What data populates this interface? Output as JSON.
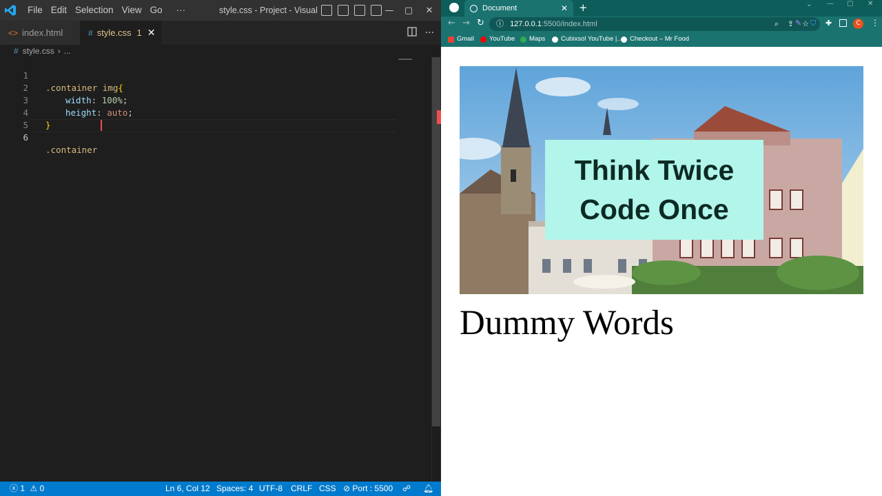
{
  "vscode": {
    "menu": [
      "File",
      "Edit",
      "Selection",
      "View",
      "Go",
      "···"
    ],
    "title": "style.css - Project - Visual ...",
    "window_controls": [
      "—",
      "▢",
      "✕"
    ],
    "tabs": {
      "index": {
        "label": "index.html",
        "icon": "<>"
      },
      "style": {
        "label": "style.css",
        "icon": "#",
        "errors": "1",
        "close": "✕"
      }
    },
    "breadcrumb": {
      "file": "style.css",
      "rest": "..."
    },
    "code_lines": [
      {
        "n": "1"
      },
      {
        "n": "2"
      },
      {
        "n": "3"
      },
      {
        "n": "4"
      },
      {
        "n": "5"
      },
      {
        "n": "6"
      }
    ],
    "tokens": {
      "l1_selector": ".container img",
      "l1_brace": "{",
      "l2_prop": "width",
      "l2_colon": ": ",
      "l2_val": "100%",
      "l2_semi": ";",
      "l3_prop": "height",
      "l3_colon": ": ",
      "l3_val": "auto",
      "l3_semi": ";",
      "l4_brace": "}",
      "l6_text": ".container "
    },
    "status": {
      "errors": "1",
      "warnings": "0",
      "position": "Ln 6, Col 12",
      "spaces": "Spaces: 4",
      "encoding": "UTF-8",
      "eol": "CRLF",
      "language": "CSS",
      "port": "Port : 5500"
    }
  },
  "chrome": {
    "tab_title": "Document",
    "tab_close": "✕",
    "new_tab": "+",
    "url_host": "127.0.0.1",
    "url_path": ":5500/index.html",
    "bookmarks": [
      {
        "label": "Gmail",
        "color": "#ea4335"
      },
      {
        "label": "YouTube",
        "color": "#ff0000"
      },
      {
        "label": "Maps",
        "color": "#34a853"
      },
      {
        "label": "Cubixsol YouTube |...",
        "color": "#ffffff"
      },
      {
        "label": "Checkout – Mr Food",
        "color": "#ffffff"
      }
    ],
    "profile_initial": "C"
  },
  "page": {
    "hero_line1": "Think Twice",
    "hero_line2": "Code Once",
    "heading": "Dummy Words"
  },
  "colors": {
    "vscode_bg": "#1e1e1e",
    "status_bar": "#007acc",
    "chrome_theme": "#1b7370",
    "hero_overlay": "#b2f5ea"
  }
}
